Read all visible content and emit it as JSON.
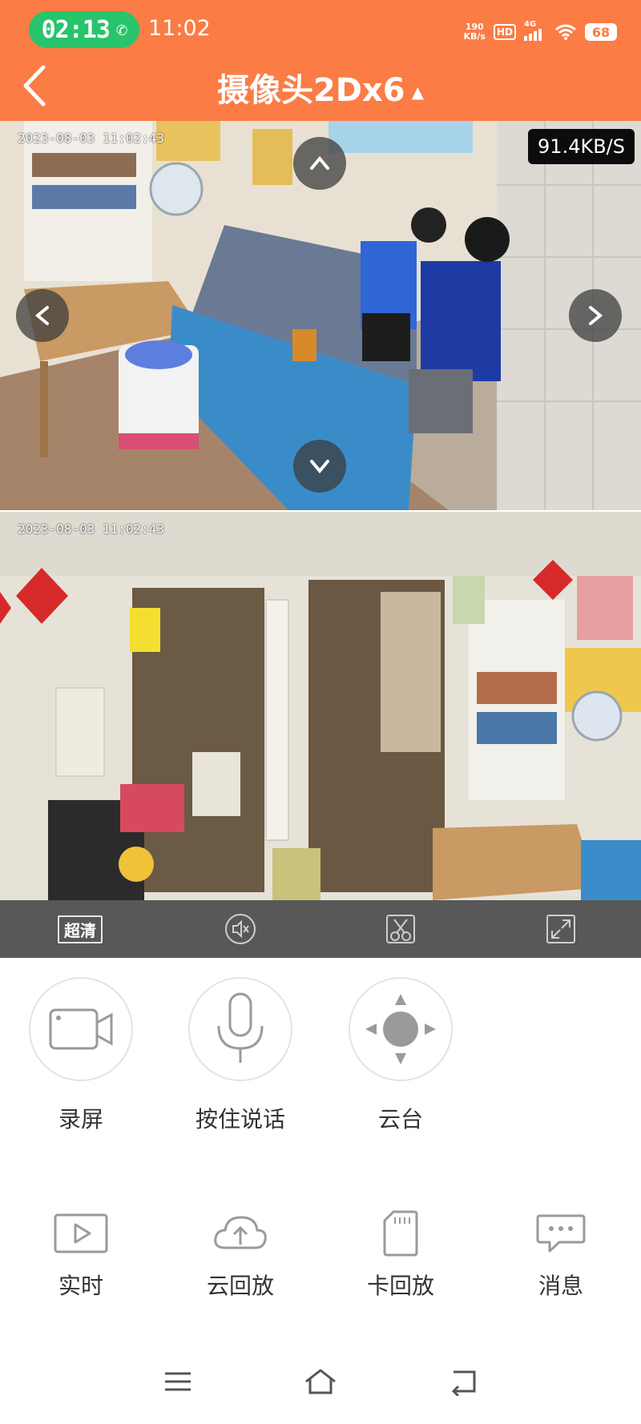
{
  "status_bar": {
    "call_timer": "02:13",
    "time": "11:02",
    "net_speed_value": "190",
    "net_speed_unit": "KB/s",
    "hd_label": "HD",
    "network_type": "4G",
    "battery": "68"
  },
  "header": {
    "title": "摄像头2Dx6",
    "caret": "▲"
  },
  "feeds": [
    {
      "timestamp": "2023-08-03 11:02:43",
      "speed": "91.4KB/S"
    },
    {
      "timestamp": "2023-08-03 11:02:43"
    }
  ],
  "control_bar": {
    "quality_label": "超清",
    "icons": [
      "mute-icon",
      "screenshot-icon",
      "fullscreen-icon"
    ]
  },
  "actions": [
    {
      "label": "录屏",
      "icon": "video-camera-icon"
    },
    {
      "label": "按住说话",
      "icon": "microphone-icon"
    },
    {
      "label": "云台",
      "icon": "ptz-joystick-icon"
    }
  ],
  "bottom_nav": [
    {
      "label": "实时",
      "icon": "play-icon"
    },
    {
      "label": "云回放",
      "icon": "cloud-upload-icon"
    },
    {
      "label": "卡回放",
      "icon": "sd-card-icon"
    },
    {
      "label": "消息",
      "icon": "message-icon"
    }
  ],
  "colors": {
    "header_bg": "#fb7c45",
    "call_pill": "#27c46b",
    "control_bar": "#585858"
  }
}
